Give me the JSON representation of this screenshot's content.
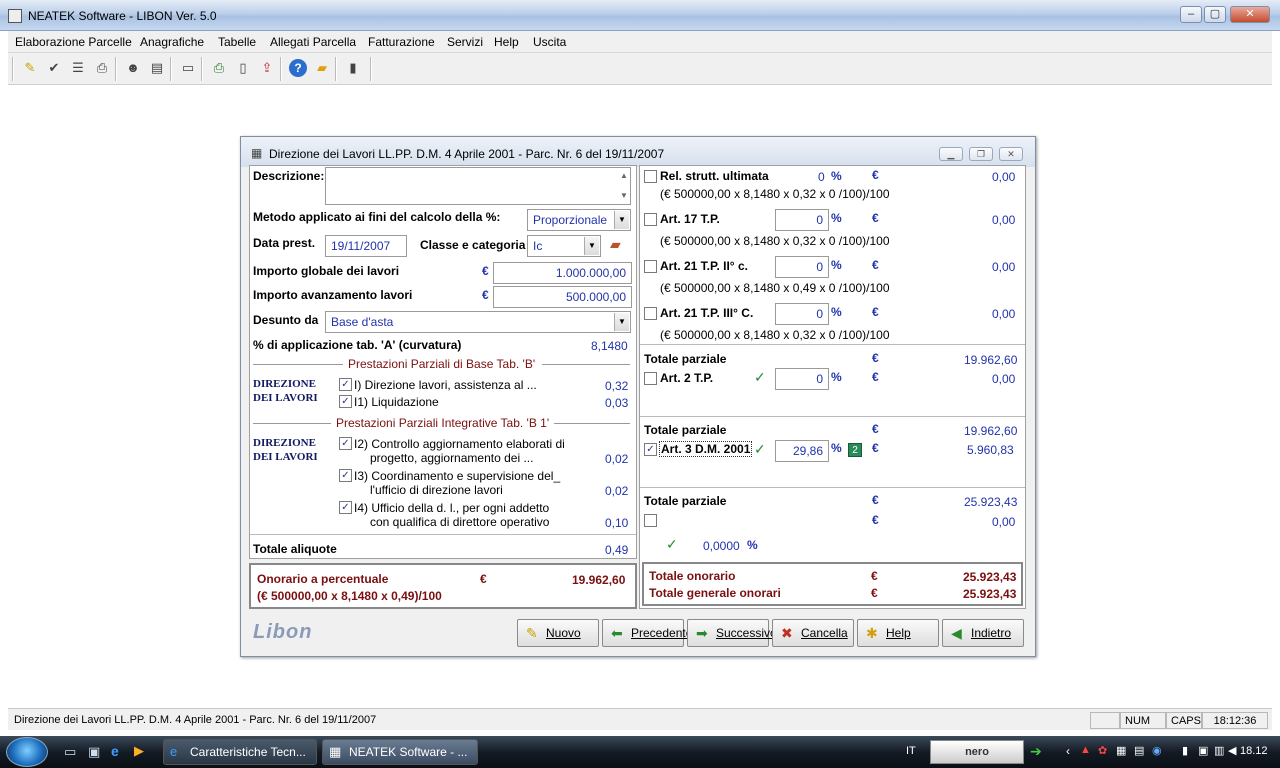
{
  "app": {
    "title": "NEATEK Software  -  LIBON Ver. 5.0"
  },
  "menu": [
    "Elaborazione Parcelle",
    "Anagrafiche",
    "Tabelle",
    "Allegati Parcella",
    "Fatturazione",
    "Servizi",
    "Help",
    "Uscita"
  ],
  "toolbar_icons": [
    "edit-icon",
    "check-doc-icon",
    "list-icon",
    "printer-icon",
    "users-icon",
    "report-icon",
    "window-icon",
    "print-preview-icon",
    "document-icon",
    "export-icon",
    "help-icon",
    "folder-open-icon",
    "exit-icon"
  ],
  "dialog": {
    "title": "Direzione dei Lavori LL.PP. D.M. 4 Aprile 2001 - Parc. Nr. 6  del 19/11/2007",
    "left": {
      "descrizione_label": "Descrizione:",
      "descrizione_value": "",
      "metodo_label": "Metodo applicato ai fini del calcolo della %:",
      "metodo_value": "Proporzionale",
      "data_label": "Data prest.",
      "data_value": "19/11/2007",
      "classe_label": "Classe e categoria",
      "classe_value": "Ic",
      "importo_globale_label": "Importo globale dei lavori",
      "importo_globale_value": "1.000.000,00",
      "importo_avanz_label": "Importo avanzamento lavori",
      "importo_avanz_value": "500.000,00",
      "euro": "€",
      "desunto_label": "Desunto da",
      "desunto_value": "Base d'asta",
      "perc_label": "% di applicazione tab. 'A' (curvatura)",
      "perc_value": "8,1480",
      "sec_base_title": "Prestazioni Parziali di Base Tab. 'B'",
      "group1": "DIREZIONE DEI LAVORI",
      "base_items": [
        {
          "label": "I) Direzione lavori, assistenza al ...",
          "value": "0,32",
          "checked": true
        },
        {
          "label": "I1) Liquidazione",
          "value": "0,03",
          "checked": true
        }
      ],
      "sec_integr_title": "Prestazioni Parziali Integrative Tab. 'B 1'",
      "group2": "DIREZIONE DEI LAVORI",
      "integr_items": [
        {
          "label1": "I2) Controllo aggiornamento elaborati di",
          "label2": "progetto, aggiornamento dei ...",
          "value": "0,02",
          "checked": true
        },
        {
          "label1": "I3) Coordinamento e supervisione del_",
          "label2": "l'ufficio di direzione lavori",
          "value": "0,02",
          "checked": true
        },
        {
          "label1": "I4) Ufficio  della d. l.,   per ogni  addetto",
          "label2": "con qualifica di direttore operativo",
          "value": "0,10",
          "checked": true
        }
      ],
      "totale_aliquote_label": "Totale aliquote",
      "totale_aliquote_value": "0,49",
      "onorario_label": "Onorario a percentuale",
      "onorario_value": "19.962,60",
      "onorario_formula": "(€ 500000,00 x 8,1480 x 0,49)/100"
    },
    "right": {
      "percent": "%",
      "euro": "€",
      "rows": [
        {
          "label": "Rel. strutt. ultimata",
          "input": "0",
          "value": "0,00",
          "formula": "(€ 500000,00 x 8,1480 x 0,32 x 0 /100)/100",
          "checked": false
        },
        {
          "label": "Art. 17 T.P.",
          "input": "0",
          "value": "0,00",
          "formula": "(€ 500000,00 x 8,1480 x 0,32 x 0 /100)/100",
          "checked": false
        },
        {
          "label": "Art. 21 T.P. II° c.",
          "input": "0",
          "value": "0,00",
          "formula": "(€ 500000,00 x 8,1480 x 0,49 x 0 /100)/100",
          "checked": false
        },
        {
          "label": "Art. 21 T.P. III° C.",
          "input": "0",
          "value": "0,00",
          "formula": "(€ 500000,00 x 8,1480 x 0,32 x 0 /100)/100",
          "checked": false
        }
      ],
      "totale_parziale_label": "Totale parziale",
      "totale_parziale_1": "19.962,60",
      "art2_label": "Art. 2 T.P.",
      "art2_input": "0",
      "art2_value": "0,00",
      "totale_parziale_2": "19.962,60",
      "art3_label": "Art. 3 D.M. 2001",
      "art3_input": "29,86",
      "art3_value": "5.960,83",
      "totale_parziale_3": "25.923,43",
      "extra_value": "0,00",
      "extra_percent": "0,0000",
      "totale_onorario_label": "Totale onorario",
      "totale_onorario_value": "25.923,43",
      "totale_generale_label": "Totale generale onorari",
      "totale_generale_value": "25.923,43"
    },
    "logo": "Libon",
    "buttons": [
      "Nuovo",
      "Precedente",
      "Successivo",
      "Cancella",
      "Help",
      "Indietro"
    ]
  },
  "status": {
    "text": "Direzione dei Lavori LL.PP. D.M. 4 Aprile 2001 - Parc. Nr. 6  del 19/11/2007",
    "num": "NUM",
    "caps": "CAPS",
    "time": "18:12:36"
  },
  "taskbar": {
    "items": [
      "Caratteristiche Tecn...",
      "NEATEK Software  - ..."
    ],
    "lang": "IT",
    "nero": "nero",
    "clock": "18.12"
  }
}
